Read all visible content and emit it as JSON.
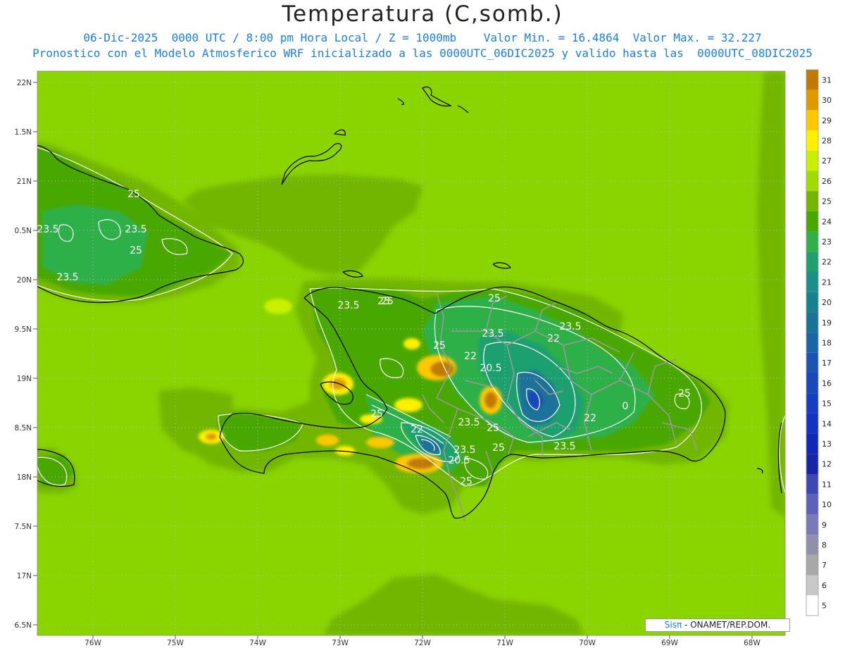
{
  "header": {
    "title": "Temperatura (C,somb.)",
    "line1": "06-Dic-2025  0000 UTC / 8:00 pm Hora Local / Z = 1000mb    Valor Min. = 16.4864  Valor Max. = 32.227",
    "line2": "Pronostico con el Modelo Atmosferico WRF inicializado a las 0000UTC_06DIC2025 y valido hasta las  0000UTC_08DIC2025"
  },
  "map": {
    "lat_labels": [
      "22N",
      "1.5N",
      "21N",
      "0.5N",
      "20N",
      "9.5N",
      "19N",
      "8.5N",
      "18N",
      "7.5N",
      "17N",
      "6.5N"
    ],
    "lon_labels": [
      "76W",
      "75W",
      "74W",
      "73W",
      "72W",
      "71W",
      "70W",
      "69W",
      "68W"
    ],
    "background_color": "#8ad400",
    "contour_labels": [
      {
        "text": "25"
      },
      {
        "text": "23.5"
      },
      {
        "text": "23.5"
      },
      {
        "text": "25"
      },
      {
        "text": "23.5"
      },
      {
        "text": "23.5"
      },
      {
        "text": "25"
      },
      {
        "text": "25"
      },
      {
        "text": "23.5"
      },
      {
        "text": "23.5"
      },
      {
        "text": "22"
      },
      {
        "text": "25"
      },
      {
        "text": "22"
      },
      {
        "text": "20.5"
      },
      {
        "text": "25"
      },
      {
        "text": "25"
      },
      {
        "text": "25"
      },
      {
        "text": "23.5"
      },
      {
        "text": "25"
      },
      {
        "text": "22"
      },
      {
        "text": "22"
      },
      {
        "text": "23.5"
      },
      {
        "text": "25"
      },
      {
        "text": "23.5"
      },
      {
        "text": "20.5"
      },
      {
        "text": "25"
      },
      {
        "text": "0"
      }
    ]
  },
  "colorbar": {
    "levels": [
      "31",
      "30",
      "29",
      "28",
      "27",
      "26",
      "25",
      "24",
      "23",
      "22",
      "21",
      "20",
      "19",
      "18",
      "17",
      "16",
      "15",
      "14",
      "13",
      "12",
      "11",
      "10",
      "9",
      "8",
      "7",
      "6",
      "5"
    ],
    "colors": [
      "#c07a00",
      "#e09a00",
      "#ffc800",
      "#fff000",
      "#c8f000",
      "#a0dc00",
      "#72b600",
      "#48a800",
      "#2fb04a",
      "#1fa070",
      "#1a9088",
      "#17828f",
      "#1a7299",
      "#1b65a6",
      "#1a55b3",
      "#1848bc",
      "#163dc2",
      "#1432c4",
      "#1228b8",
      "#1a24a8",
      "#3d48b4",
      "#5c62b8",
      "#7a7ab8",
      "#9090a8",
      "#a8a8a8",
      "#c8c8c8",
      "#ffffff"
    ]
  },
  "credit": {
    "brand": "Sisπ",
    "text": " - ONAMET/REP.DOM."
  }
}
